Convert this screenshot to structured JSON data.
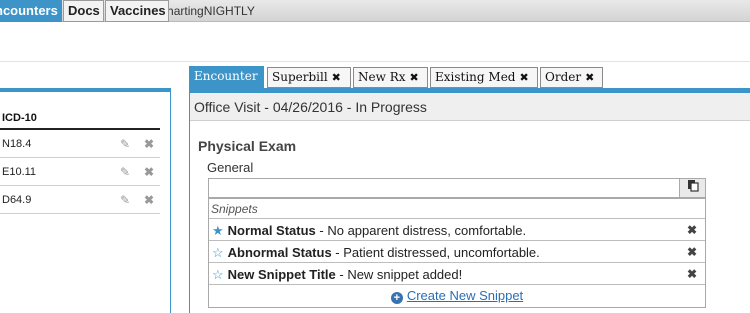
{
  "window": {
    "title": "Falcon ChartingNIGHTLY"
  },
  "left": {
    "tabs": [
      {
        "label": "ncounters",
        "active": true
      },
      {
        "label": "Docs",
        "active": false
      },
      {
        "label": "Vaccines",
        "active": false
      }
    ],
    "table": {
      "header": "ICD-10",
      "rows": [
        {
          "code": "N18.4"
        },
        {
          "code": "E10.11"
        },
        {
          "code": "D64.9"
        }
      ]
    }
  },
  "right": {
    "tabs": [
      {
        "label": "Encounter",
        "active": true,
        "closable": false
      },
      {
        "label": "Superbill",
        "active": false,
        "closable": true
      },
      {
        "label": "New Rx",
        "active": false,
        "closable": true
      },
      {
        "label": "Existing Med",
        "active": false,
        "closable": true
      },
      {
        "label": "Order",
        "active": false,
        "closable": true
      }
    ],
    "visit_header": "Office Visit - 04/26/2016 - In Progress",
    "section_title": "Physical Exam",
    "field_label": "General",
    "general_value": "",
    "snippets": {
      "header": "Snippets",
      "items": [
        {
          "title": "Normal Status",
          "text": " - No apparent distress, comfortable.",
          "starred": true
        },
        {
          "title": "Abnormal Status",
          "text": " - Patient distressed, uncomfortable.",
          "starred": false
        },
        {
          "title": "New Snippet Title",
          "text": " - New snippet added!",
          "starred": false
        }
      ],
      "create_label": "Create New Snippet"
    }
  },
  "icons": {
    "close": "close-icon",
    "edit": "pencil-icon",
    "copy": "clipboard-icon",
    "star": "star-icon",
    "add": "plus-circle-icon"
  },
  "colors": {
    "accent": "#3c94c8",
    "link": "#2a6fb5"
  }
}
